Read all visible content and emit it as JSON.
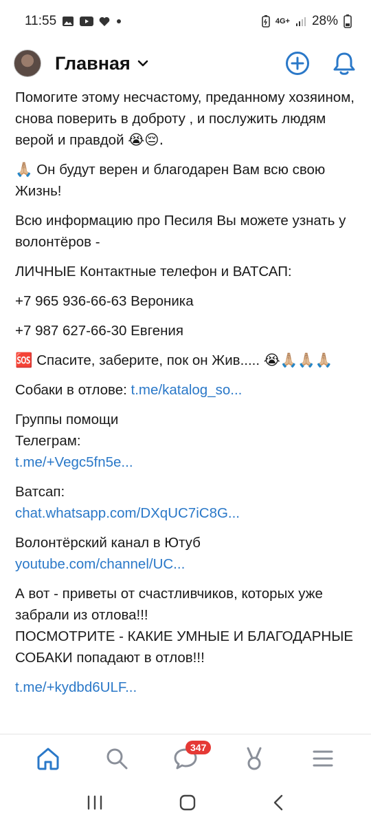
{
  "status_bar": {
    "time": "11:55",
    "network": "4G+",
    "battery": "28%"
  },
  "header": {
    "title": "Главная"
  },
  "post": {
    "p1_line1": "Помогите этому несчастому, преданному хозяином,",
    "p1_line2": "снова поверить в доброту , и послужить людям верой и правдой",
    "p1_emoji": "😭😔.",
    "p2_emoji": "🙏🏼",
    "p2_text": "Он будут верен и благодарен Вам всю свою Жизнь!",
    "p3": "Всю информацию про Песиля Вы можете узнать у волонтёров -",
    "p4": "ЛИЧНЫЕ Контактные телефон и ВАТСАП:",
    "phone1": "+7 965 936-66-63 Вероника",
    "phone2": "+7 987 627-66-30 Евгения",
    "sos_emoji": "🆘",
    "sos_text": "Спасите, заберите, пок он  Жив.....",
    "sos_emoji_tail": "😭🙏🏼🙏🏼🙏🏼",
    "catch_label": "Собаки в отлове:",
    "catch_link": "t.me/katalog_so...",
    "groups_label": "Группы помощи",
    "telegram_label": "Телеграм:",
    "telegram_link": "t.me/+Vegc5fn5e...",
    "whatsapp_label": "Ватсап:",
    "whatsapp_link": "chat.whatsapp.com/DXqUC7iC8G...",
    "youtube_label": "Волонтёрский канал в Ютуб",
    "youtube_link": "youtube.com/channel/UC...",
    "final_line1": "А вот - приветы от счастливчиков, которых уже забрали из отлова!!!",
    "final_line2": "ПОСМОТРИТЕ - КАКИЕ  УМНЫЕ И БЛАГОДАРНЫЕ СОБАКИ попадают в отлов!!!",
    "final_link": "t.me/+kydbd6ULF..."
  },
  "bottom_nav": {
    "messages_badge": "347"
  },
  "colors": {
    "accent": "#2a78c8",
    "badge": "#e53935"
  }
}
